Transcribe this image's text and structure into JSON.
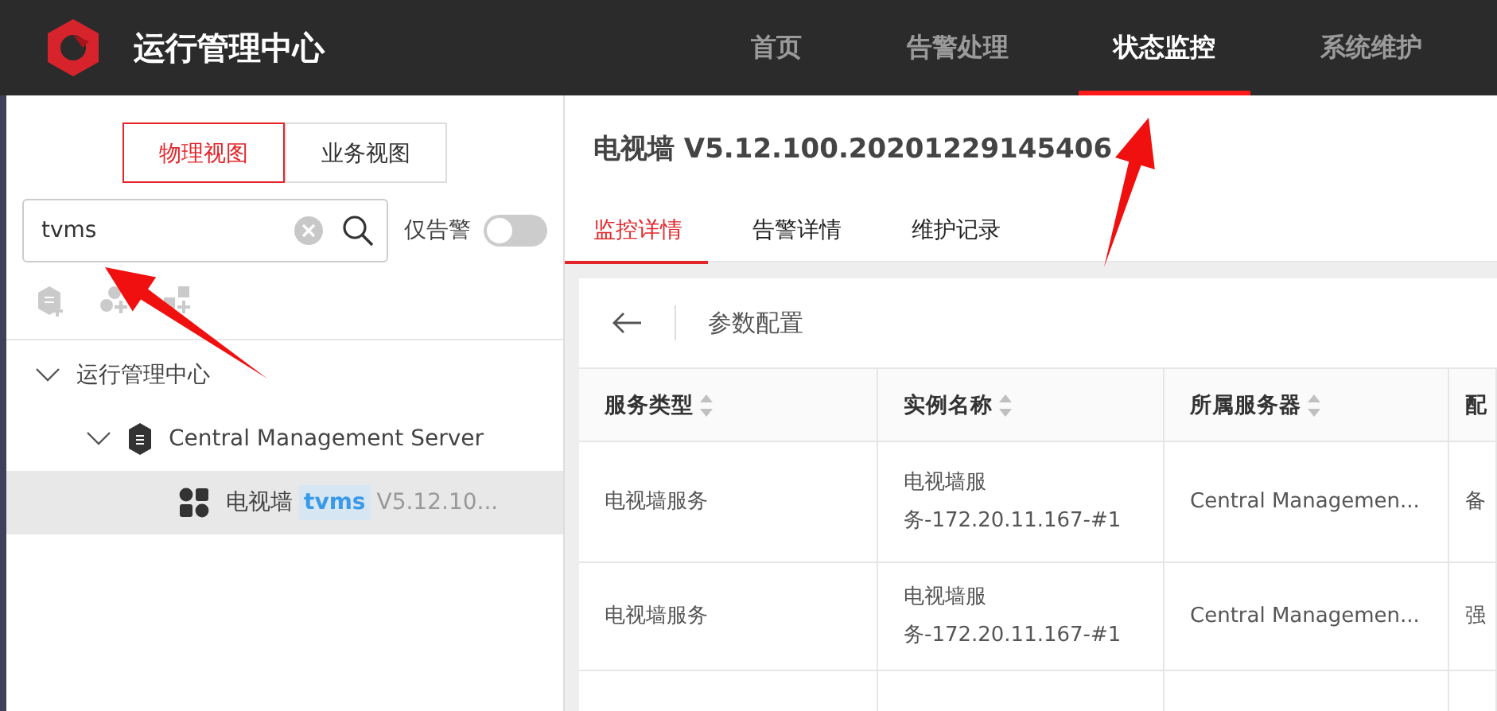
{
  "app": {
    "title": "运行管理中心"
  },
  "nav": [
    {
      "label": "首页",
      "selected": false
    },
    {
      "label": "告警处理",
      "selected": false
    },
    {
      "label": "状态监控",
      "selected": true
    },
    {
      "label": "系统维护",
      "selected": false
    }
  ],
  "sidebar": {
    "view_tabs": [
      {
        "label": "物理视图",
        "selected": true
      },
      {
        "label": "业务视图",
        "selected": false
      }
    ],
    "search": {
      "value": "tvms"
    },
    "alarm_only": {
      "label": "仅告警",
      "on": false
    },
    "toolbar": [
      {
        "kind": "server-add",
        "disabled": true
      },
      {
        "kind": "group-add",
        "disabled": true
      },
      {
        "kind": "grid",
        "disabled": true
      }
    ],
    "tree": [
      {
        "label": "运行管理中心",
        "expanded": true,
        "selected": false,
        "children": [
          {
            "kind": "server",
            "label": "Central Management Server",
            "expanded": true,
            "selected": false,
            "children": [
              {
                "kind": "service",
                "label": "电视墙",
                "tag": "tvms",
                "version": "V5.12.10...",
                "selected": true
              }
            ]
          }
        ]
      }
    ]
  },
  "detail": {
    "title": "电视墙 V5.12.100.20201229145406",
    "tabs": [
      {
        "label": "监控详情",
        "selected": true
      },
      {
        "label": "告警详情",
        "selected": false
      },
      {
        "label": "维护记录",
        "selected": false
      }
    ],
    "panel": {
      "title": "参数配置",
      "table": {
        "columns": [
          {
            "label": "服务类型",
            "sortable": true
          },
          {
            "label": "实例名称",
            "sortable": true
          },
          {
            "label": "所属服务器",
            "sortable": true
          },
          {
            "label": "配",
            "sortable": false
          }
        ],
        "rows": [
          [
            "电视墙服务",
            "电视墙服务-172.20.11.167-#1",
            "Central Managemen...",
            "备"
          ],
          [
            "电视墙服务",
            "电视墙服务-172.20.11.167-#1",
            "Central Managemen...",
            "强"
          ]
        ]
      }
    }
  }
}
